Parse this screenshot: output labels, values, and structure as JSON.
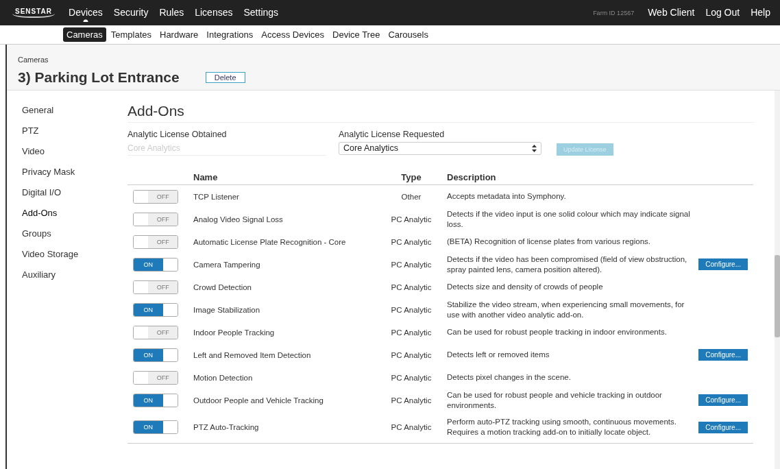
{
  "top_nav": {
    "logo": "SENSTAR",
    "items": [
      {
        "label": "Devices",
        "selected": true
      },
      {
        "label": "Security",
        "selected": false
      },
      {
        "label": "Rules",
        "selected": false
      },
      {
        "label": "Licenses",
        "selected": false
      },
      {
        "label": "Settings",
        "selected": false
      }
    ],
    "farm_id": "Farm ID 12567",
    "links": [
      "Web Client",
      "Log Out",
      "Help"
    ]
  },
  "sub_nav": [
    {
      "label": "Cameras",
      "selected": true
    },
    {
      "label": "Templates",
      "selected": false
    },
    {
      "label": "Hardware",
      "selected": false
    },
    {
      "label": "Integrations",
      "selected": false
    },
    {
      "label": "Access Devices",
      "selected": false
    },
    {
      "label": "Device Tree",
      "selected": false
    },
    {
      "label": "Carousels",
      "selected": false
    }
  ],
  "breadcrumb": "Cameras",
  "page_title": "3) Parking Lot Entrance",
  "delete_button": "Delete",
  "sidebar": {
    "items": [
      {
        "label": "General",
        "selected": false
      },
      {
        "label": "PTZ",
        "selected": false
      },
      {
        "label": "Video",
        "selected": false
      },
      {
        "label": "Privacy Mask",
        "selected": false
      },
      {
        "label": "Digital I/O",
        "selected": false
      },
      {
        "label": "Add-Ons",
        "selected": true
      },
      {
        "label": "Groups",
        "selected": false
      },
      {
        "label": "Video Storage",
        "selected": false
      },
      {
        "label": "Auxiliary",
        "selected": false
      }
    ]
  },
  "section_title": "Add-Ons",
  "license_obtained": {
    "label": "Analytic License Obtained",
    "value": "Core Analytics"
  },
  "license_requested": {
    "label": "Analytic License Requested",
    "value": "Core Analytics"
  },
  "update_button": {
    "label": "Update License",
    "disabled": true
  },
  "table": {
    "columns": [
      "Name",
      "Type",
      "Description"
    ],
    "rows": [
      {
        "on": false,
        "toggle_label": "OFF",
        "name": "TCP Listener",
        "type": "Other",
        "description": "Accepts metadata into Symphony."
      },
      {
        "on": false,
        "toggle_label": "OFF",
        "name": "Analog Video Signal Loss",
        "type": "PC Analytic",
        "description": "Detects if the video input is one solid colour which may indicate signal loss."
      },
      {
        "on": false,
        "toggle_label": "OFF",
        "name": "Automatic License Plate Recognition - Core",
        "type": "PC Analytic",
        "description": "(BETA) Recognition of license plates from various regions."
      },
      {
        "on": true,
        "toggle_label": "ON",
        "name": "Camera Tampering",
        "type": "PC Analytic",
        "description": "Detects if the video has been compromised (field of view obstruction, spray painted lens, camera position altered).",
        "configure": "Configure..."
      },
      {
        "on": false,
        "toggle_label": "OFF",
        "name": "Crowd Detection",
        "type": "PC Analytic",
        "description": "Detects size and density of crowds of people"
      },
      {
        "on": true,
        "toggle_label": "ON",
        "name": "Image Stabilization",
        "type": "PC Analytic",
        "description": "Stabilize the video stream, when experiencing small movements, for use with another video analytic add-on."
      },
      {
        "on": false,
        "toggle_label": "OFF",
        "name": "Indoor People Tracking",
        "type": "PC Analytic",
        "description": "Can be used for robust people tracking in indoor environments."
      },
      {
        "on": true,
        "toggle_label": "ON",
        "name": "Left and Removed Item Detection",
        "type": "PC Analytic",
        "description": "Detects left or removed items",
        "configure": "Configure..."
      },
      {
        "on": false,
        "toggle_label": "OFF",
        "name": "Motion Detection",
        "type": "PC Analytic",
        "description": "Detects pixel changes in the scene."
      },
      {
        "on": true,
        "toggle_label": "ON",
        "name": "Outdoor People and Vehicle Tracking",
        "type": "PC Analytic",
        "description": "Can be used for robust people and vehicle tracking in outdoor environments.",
        "configure": "Configure..."
      },
      {
        "on": true,
        "toggle_label": "ON",
        "name": "PTZ Auto-Tracking",
        "type": "PC Analytic",
        "description": "Perform auto-PTZ tracking using smooth, continuous movements. Requires a motion tracking add-on to initially locate object.",
        "configure": "Configure..."
      }
    ]
  }
}
